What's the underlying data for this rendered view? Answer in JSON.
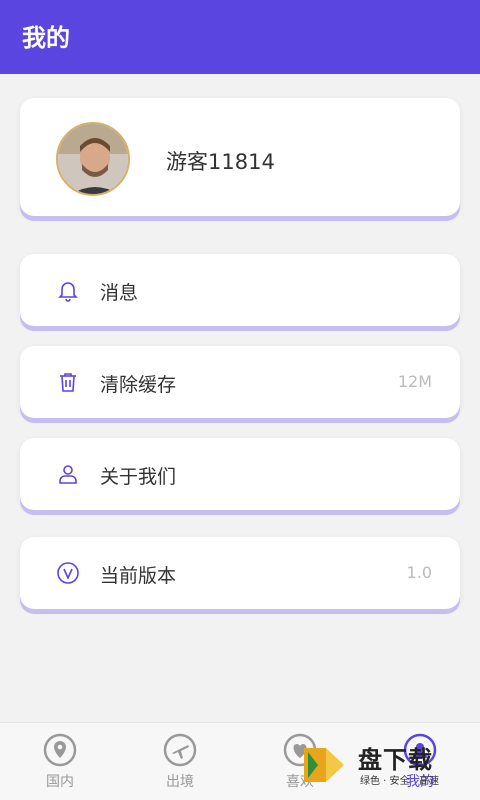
{
  "header": {
    "title": "我的"
  },
  "profile": {
    "username": "游客11814"
  },
  "menu": [
    {
      "label": "消息",
      "icon": "bell-icon",
      "value": ""
    },
    {
      "label": "清除缓存",
      "icon": "trash-icon",
      "value": "12M"
    },
    {
      "label": "关于我们",
      "icon": "person-icon",
      "value": ""
    },
    {
      "label": "当前版本",
      "icon": "version-icon",
      "value": "1.0"
    }
  ],
  "tabs": [
    {
      "label": "国内",
      "icon": "location-pin-icon"
    },
    {
      "label": "出境",
      "icon": "airplane-icon"
    },
    {
      "label": "喜欢",
      "icon": "heart-icon"
    },
    {
      "label": "我的",
      "icon": "user-icon",
      "active": true
    }
  ],
  "watermark": {
    "brand": "盘下载",
    "slogan": "绿色 · 安全 · 高速"
  },
  "colors": {
    "accent": "#5b45e0",
    "card_shadow": "#c6bdf0",
    "icon": "#5b45e0",
    "tab_inactive": "#999999"
  }
}
